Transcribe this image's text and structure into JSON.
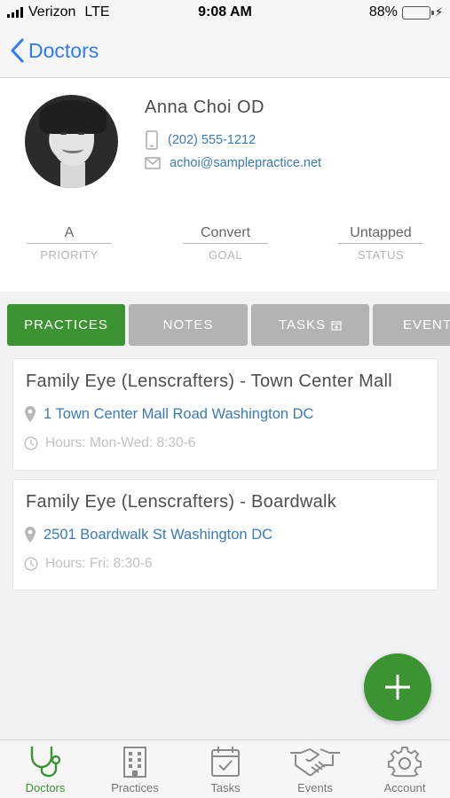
{
  "status_bar": {
    "carrier": "Verizon",
    "network": "LTE",
    "time": "9:08 AM",
    "battery": "88%",
    "battery_level": 0.88
  },
  "nav": {
    "back_label": "Doctors"
  },
  "doctor": {
    "name": "Anna Choi OD",
    "phone": "(202) 555-1212",
    "email": "achoi@samplepractice.net"
  },
  "stats": [
    {
      "value": "A",
      "label": "PRIORITY"
    },
    {
      "value": "Convert",
      "label": "GOAL"
    },
    {
      "value": "Untapped",
      "label": "STATUS"
    }
  ],
  "tabs": [
    {
      "label": "PRACTICES",
      "active": true
    },
    {
      "label": "NOTES",
      "active": false
    },
    {
      "label": "TASKS",
      "active": false
    },
    {
      "label": "EVENTS",
      "active": false
    }
  ],
  "practices": [
    {
      "name": "Family Eye (Lenscrafters) - Town Center Mall",
      "address": "1 Town Center Mall Road Washington DC",
      "hours": "Hours: Mon-Wed: 8:30-6"
    },
    {
      "name": "Family Eye (Lenscrafters) - Boardwalk",
      "address": "2501 Boardwalk St Washington DC",
      "hours": "Hours: Fri: 8:30-6"
    }
  ],
  "tab_bar": [
    {
      "label": "Doctors",
      "icon": "stethoscope-icon",
      "active": true
    },
    {
      "label": "Practices",
      "icon": "building-icon",
      "active": false
    },
    {
      "label": "Tasks",
      "icon": "calendar-check-icon",
      "active": false
    },
    {
      "label": "Events",
      "icon": "handshake-icon",
      "active": false
    },
    {
      "label": "Account",
      "icon": "gear-icon",
      "active": false
    }
  ],
  "colors": {
    "accent_green": "#3c9332",
    "link_blue": "#3a7ab8",
    "ios_blue": "#2f7cf6",
    "tab_inactive": "#b3b3b3"
  }
}
